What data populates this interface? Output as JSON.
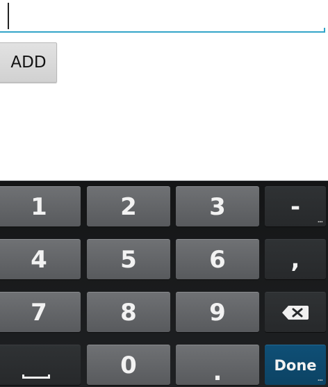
{
  "input": {
    "value": "",
    "accent_color": "#33a4c8"
  },
  "add_button": {
    "label": "ADD"
  },
  "keyboard": {
    "rows": [
      [
        "1",
        "2",
        "3",
        "-"
      ],
      [
        "4",
        "5",
        "6",
        ","
      ],
      [
        "7",
        "8",
        "9",
        "backspace-icon"
      ],
      [
        "space-icon",
        "0",
        ".",
        "Done"
      ]
    ],
    "done_color": "#0c4364",
    "more_indicator": "..."
  }
}
